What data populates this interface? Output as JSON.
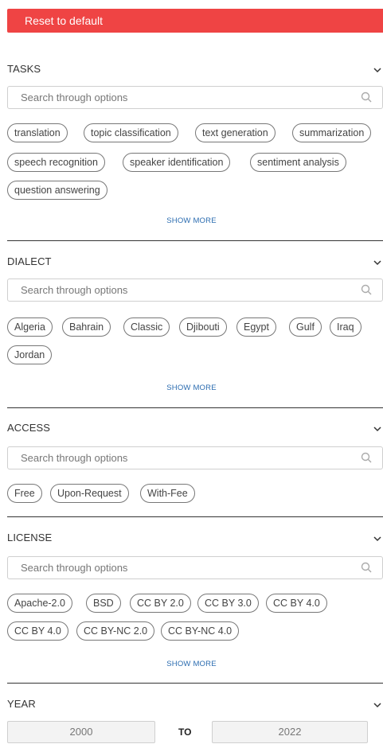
{
  "reset_label": "Reset to default",
  "search_placeholder": "Search through options",
  "show_more_label": "SHOW MORE",
  "sections": {
    "tasks": {
      "title": "TASKS",
      "chips": [
        "translation",
        "topic classification",
        "text generation",
        "summarization",
        "speech recognition",
        "speaker identification",
        "sentiment analysis",
        "question answering"
      ]
    },
    "dialect": {
      "title": "DIALECT",
      "chips": [
        "Algeria",
        "Bahrain",
        "Classic",
        "Djibouti",
        "Egypt",
        "Gulf",
        "Iraq",
        "Jordan"
      ]
    },
    "access": {
      "title": "ACCESS",
      "chips": [
        "Free",
        "Upon-Request",
        "With-Fee"
      ]
    },
    "license": {
      "title": "LICENSE",
      "chips": [
        "Apache-2.0",
        "BSD",
        "CC BY 2.0",
        "CC BY 3.0",
        "CC BY 4.0",
        "CC BY 4.0",
        "CC BY-NC 2.0",
        "CC BY-NC 4.0"
      ]
    },
    "year": {
      "title": "YEAR",
      "from": "2000",
      "to_label": "TO",
      "to": "2022"
    }
  },
  "colors": {
    "reset_bg": "#ef4444",
    "link": "#2b6cb0",
    "chip_border": "#777777"
  },
  "icons": {
    "collapse": "chevron-down-icon",
    "search": "search-icon"
  }
}
